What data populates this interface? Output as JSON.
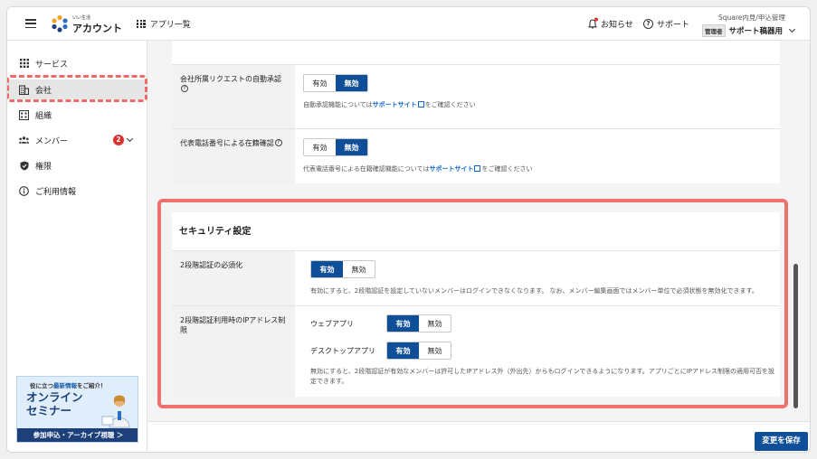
{
  "header": {
    "logo_small": "いい生活",
    "logo_main": "アカウント",
    "apps_label": "アプリ一覧",
    "notice_label": "お知らせ",
    "support_label": "サポート",
    "user_org": "Square内見/申込管理",
    "role_badge": "管理者",
    "user_name": "サポート稿器用"
  },
  "sidebar": {
    "items": [
      {
        "label": "サービス",
        "icon": "grid-icon"
      },
      {
        "label": "会社",
        "icon": "building-icon"
      },
      {
        "label": "組織",
        "icon": "org-icon"
      },
      {
        "label": "メンバー",
        "icon": "members-icon",
        "badge": "2"
      },
      {
        "label": "権限",
        "icon": "shield-icon"
      },
      {
        "label": "ご利用情報",
        "icon": "info-icon"
      }
    ],
    "banner": {
      "top_pre": "役に立つ",
      "top_highlight": "最新情報",
      "top_post": "をご紹介！",
      "title_line1": "オンライン",
      "title_line2": "セミナー",
      "footer": "参加申込・アーカイブ視聴 ＞"
    }
  },
  "settings_top": {
    "rows": [
      {
        "label": "会社所属リクエストの自動承認",
        "on_label": "有効",
        "off_label": "無効",
        "selected": "無効",
        "help_pre": "自動承認機能については",
        "help_link": "サポートサイト",
        "help_post": "をご確認ください"
      },
      {
        "label": "代表電話番号による在籍確認",
        "on_label": "有効",
        "off_label": "無効",
        "selected": "無効",
        "help_pre": "代表電話番号による在籍確認機能については",
        "help_link": "サポートサイト",
        "help_post": "をご確認ください"
      }
    ]
  },
  "security": {
    "title": "セキュリティ設定",
    "mfa": {
      "label": "2段階認証の必須化",
      "on_label": "有効",
      "off_label": "無効",
      "selected": "有効",
      "help": "有効にすると、2段階認証を設定していないメンバーはログインできなくなります。 なお、メンバー編集画面ではメンバー単位で必須状態を無効化できます。"
    },
    "ip": {
      "label": "2段階認証利用時のIPアドレス制限",
      "web_label": "ウェブアプリ",
      "desktop_label": "デスクトップアプリ",
      "on_label": "有効",
      "off_label": "無効",
      "web_selected": "有効",
      "desktop_selected": "有効",
      "help": "無効にすると、2段階認証が有効なメンバーは許可したIPアドレス外（外出先）からもログインできるようになります。アプリごとにIPアドレス制限の適用可否を設定できます。"
    }
  },
  "footer": {
    "save_label": "変更を保存"
  },
  "colors": {
    "primary": "#0f4f99",
    "link": "#1167c9",
    "badge": "#e0312c",
    "highlight": "#f07070"
  }
}
